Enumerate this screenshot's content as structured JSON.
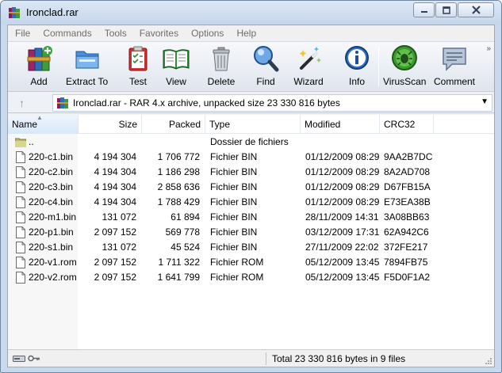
{
  "window": {
    "title": "Ironclad.rar",
    "icon": "winrar-books-icon"
  },
  "menu": [
    "File",
    "Commands",
    "Tools",
    "Favorites",
    "Options",
    "Help"
  ],
  "toolbar": {
    "buttons": [
      {
        "label": "Add",
        "icon": "add-archive-icon"
      },
      {
        "label": "Extract To",
        "icon": "extract-folder-icon"
      },
      {
        "label": "Test",
        "icon": "test-clipboard-icon"
      },
      {
        "label": "View",
        "icon": "view-book-icon"
      },
      {
        "label": "Delete",
        "icon": "trash-can-icon"
      },
      {
        "label": "Find",
        "icon": "magnifier-icon"
      },
      {
        "label": "Wizard",
        "icon": "magic-wand-icon"
      },
      {
        "label": "Info",
        "icon": "info-icon"
      },
      {
        "label": "VirusScan",
        "icon": "virus-scan-icon"
      },
      {
        "label": "Comment",
        "icon": "comment-bubble-icon"
      }
    ]
  },
  "address": {
    "text": "Ironclad.rar - RAR 4.x archive, unpacked size 23 330 816 bytes"
  },
  "columns": {
    "name": "Name",
    "size": "Size",
    "packed": "Packed",
    "type": "Type",
    "modified": "Modified",
    "crc": "CRC32"
  },
  "parent_row": {
    "name": "..",
    "type": "Dossier de fichiers"
  },
  "files": [
    {
      "name": "220-c1.bin",
      "size": "4 194 304",
      "packed": "1 706 772",
      "type": "Fichier BIN",
      "modified": "01/12/2009 08:29",
      "crc": "9AA2B7DC"
    },
    {
      "name": "220-c2.bin",
      "size": "4 194 304",
      "packed": "1 186 298",
      "type": "Fichier BIN",
      "modified": "01/12/2009 08:29",
      "crc": "8A2AD708"
    },
    {
      "name": "220-c3.bin",
      "size": "4 194 304",
      "packed": "2 858 636",
      "type": "Fichier BIN",
      "modified": "01/12/2009 08:29",
      "crc": "D67FB15A"
    },
    {
      "name": "220-c4.bin",
      "size": "4 194 304",
      "packed": "1 788 429",
      "type": "Fichier BIN",
      "modified": "01/12/2009 08:29",
      "crc": "E73EA38B"
    },
    {
      "name": "220-m1.bin",
      "size": "131 072",
      "packed": "61 894",
      "type": "Fichier BIN",
      "modified": "28/11/2009 14:31",
      "crc": "3A08BB63"
    },
    {
      "name": "220-p1.bin",
      "size": "2 097 152",
      "packed": "569 778",
      "type": "Fichier BIN",
      "modified": "03/12/2009 17:31",
      "crc": "62A942C6"
    },
    {
      "name": "220-s1.bin",
      "size": "131 072",
      "packed": "45 524",
      "type": "Fichier BIN",
      "modified": "27/11/2009 22:02",
      "crc": "372FE217"
    },
    {
      "name": "220-v1.rom",
      "size": "2 097 152",
      "packed": "1 711 322",
      "type": "Fichier ROM",
      "modified": "05/12/2009 13:45",
      "crc": "7894FB75"
    },
    {
      "name": "220-v2.rom",
      "size": "2 097 152",
      "packed": "1 641 799",
      "type": "Fichier ROM",
      "modified": "05/12/2009 13:45",
      "crc": "F5D0F1A2"
    }
  ],
  "status": {
    "text": "Total 23 330 816 bytes in 9 files"
  }
}
